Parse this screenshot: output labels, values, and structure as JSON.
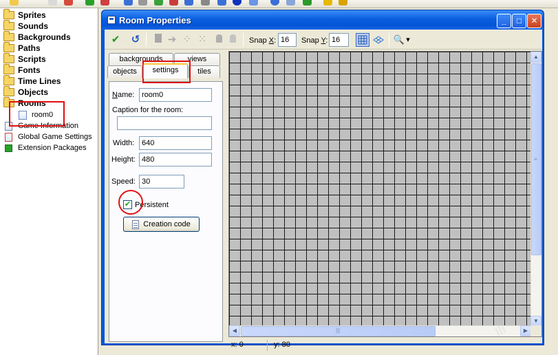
{
  "tree": {
    "folders": [
      {
        "label": "Sprites"
      },
      {
        "label": "Sounds"
      },
      {
        "label": "Backgrounds"
      },
      {
        "label": "Paths"
      },
      {
        "label": "Scripts"
      },
      {
        "label": "Fonts"
      },
      {
        "label": "Time Lines"
      },
      {
        "label": "Objects"
      },
      {
        "label": "Rooms"
      }
    ],
    "room_child": "room0",
    "extras": [
      "Game Information",
      "Global Game Settings",
      "Extension Packages"
    ]
  },
  "window": {
    "title": "Room Properties",
    "min_glyph": "_",
    "max_glyph": "□",
    "close_glyph": "✕"
  },
  "toolbar": {
    "ok_glyph": "✔",
    "undo_glyph": "↺",
    "snap_x_prefix": "Snap ",
    "snap_x_accel": "X",
    "snap_x_suffix": ":",
    "snap_x_value": "16",
    "snap_y_prefix": "Snap ",
    "snap_y_accel": "Y",
    "snap_y_suffix": ":",
    "snap_y_value": "16",
    "zoom_glyph": "🔍",
    "dropdown_glyph": "▾"
  },
  "tabs": {
    "row1": [
      "backgrounds",
      "views"
    ],
    "row2": [
      "objects",
      "settings",
      "tiles"
    ],
    "active": "settings"
  },
  "settings": {
    "name_label_accel": "N",
    "name_label_rest": "ame:",
    "name_value": "room0",
    "caption_label": "Caption for the room:",
    "caption_value": "",
    "width_label": "Width:",
    "width_value": "640",
    "height_label": "Height:",
    "height_value": "480",
    "speed_label": "Speed:",
    "speed_value": "30",
    "persistent_label": "Persistent",
    "persistent_checked": true,
    "creation_code_label": "Creation code"
  },
  "status": {
    "x": "x: 0",
    "y": "y: 80"
  },
  "colors": {
    "title_bar": "#0a5ee0",
    "grid_fill": "#c0c0c0",
    "grid_line": "#1a1a1a",
    "highlight_red": "#e01010"
  }
}
